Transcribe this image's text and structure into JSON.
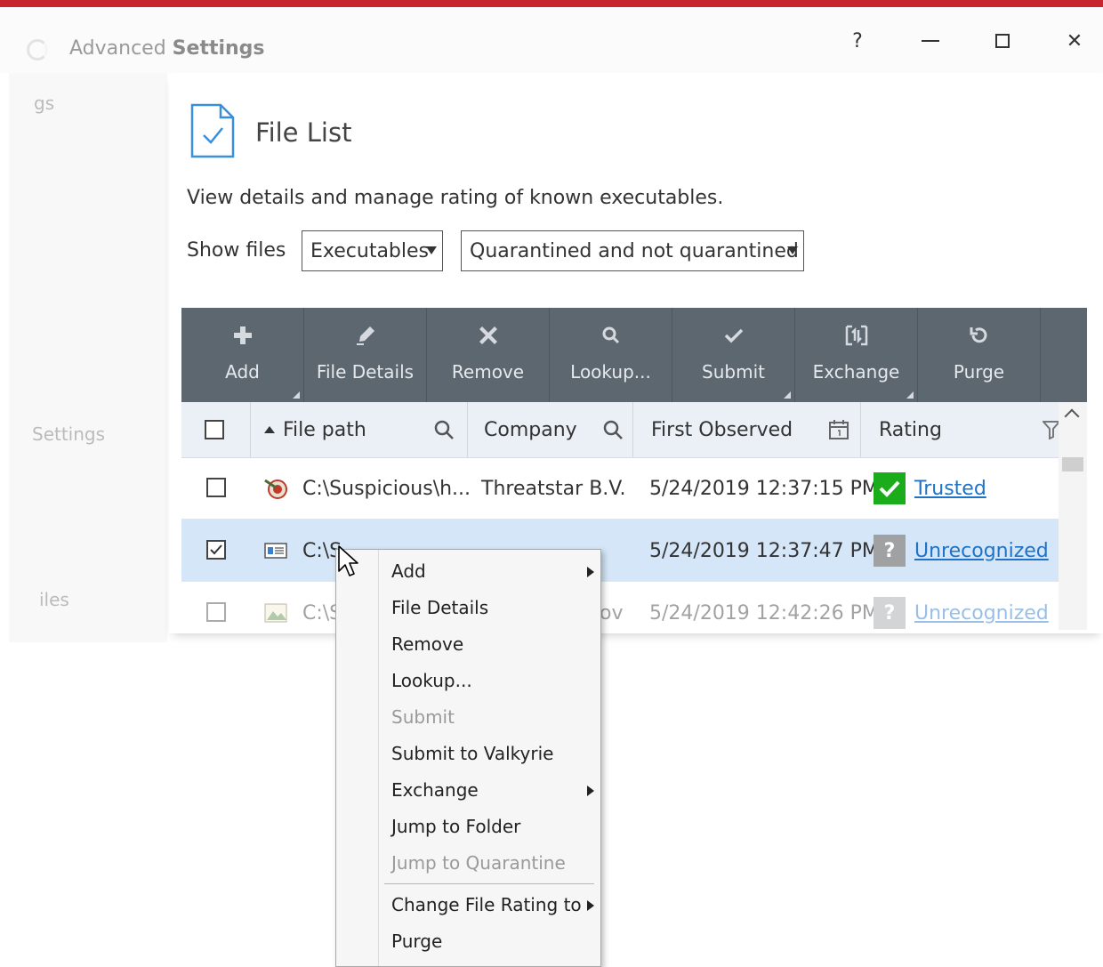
{
  "window": {
    "title_prefix": "Advanced",
    "title_main": "Settings",
    "help_label": "?",
    "close_label": "✕"
  },
  "sidebar": {
    "items": [
      {
        "label": "gs"
      },
      {
        "label": "Settings"
      },
      {
        "label": "iles"
      }
    ]
  },
  "page": {
    "title": "File List",
    "description": "View details and manage rating of known executables.",
    "show_files_label": "Show files",
    "filter_type": "Executables",
    "filter_status": "Quarantined and not quarantined"
  },
  "toolbar": {
    "buttons": [
      {
        "label": "Add",
        "icon": "plus-icon"
      },
      {
        "label": "File Details",
        "icon": "pencil-icon"
      },
      {
        "label": "Remove",
        "icon": "x-icon"
      },
      {
        "label": "Lookup...",
        "icon": "magnifier-icon"
      },
      {
        "label": "Submit",
        "icon": "checkmark-icon"
      },
      {
        "label": "Exchange",
        "icon": "exchange-icon"
      },
      {
        "label": "Purge",
        "icon": "refresh-icon"
      }
    ]
  },
  "table": {
    "columns": {
      "file_path": "File path",
      "company": "Company",
      "first_observed": "First Observed",
      "rating": "Rating"
    },
    "rows": [
      {
        "path": "C:\\Suspicious\\h...",
        "company": "Threatstar B.V.",
        "date": "5/24/2019 12:37:15 PM",
        "rating": "Trusted",
        "checked": false
      },
      {
        "path": "C:\\S",
        "company": "",
        "date": "5/24/2019 12:37:47 PM",
        "rating": "Unrecognized",
        "checked": true
      },
      {
        "path": "C:\\S",
        "company": "ov",
        "date": "5/24/2019 12:42:26 PM",
        "rating": "Unrecognized",
        "checked": false
      }
    ]
  },
  "context_menu": {
    "items": [
      {
        "label": "Add"
      },
      {
        "label": "File Details"
      },
      {
        "label": "Remove"
      },
      {
        "label": "Lookup..."
      },
      {
        "label": "Submit"
      },
      {
        "label": "Submit to Valkyrie"
      },
      {
        "label": "Exchange"
      },
      {
        "label": "Jump to Folder"
      },
      {
        "label": "Jump to Quarantine"
      },
      {
        "label": "Change File Rating to"
      },
      {
        "label": "Purge"
      }
    ]
  },
  "colors": {
    "accent_red": "#c8262e",
    "toolbar_bg": "#5d6770",
    "trusted_green": "#1bac1b",
    "link_blue": "#1e73c8",
    "selected_row": "#d4e6f7"
  }
}
